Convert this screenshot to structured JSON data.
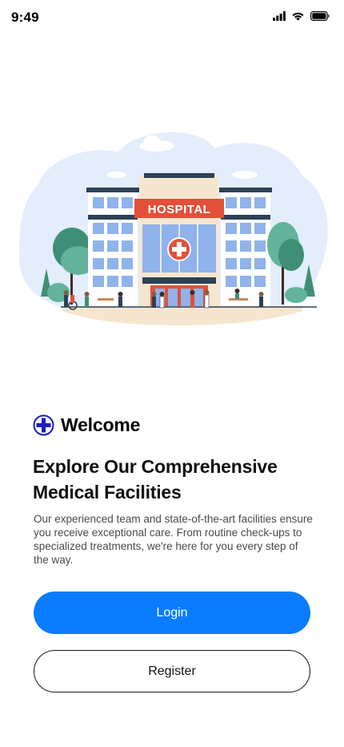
{
  "status_bar": {
    "time": "9:49",
    "icons": [
      "signal-icon",
      "wifi-icon",
      "battery-icon"
    ]
  },
  "illustration": {
    "sign_text": "HOSPITAL",
    "icon": "hospital-building-illustration"
  },
  "welcome": {
    "icon": "medical-cross-icon",
    "title": "Welcome"
  },
  "headline": "Explore Our Comprehensive Medical Facilities",
  "description": "Our experienced team and state-of-the-art facilities ensure you receive exceptional care.  From routine check-ups to specialized treatments, we're here for you every step of the way.",
  "buttons": {
    "login_label": "Login",
    "register_label": "Register"
  },
  "colors": {
    "primary": "#0a7cff",
    "sign_red": "#e2503a",
    "sky_blob": "#e3edfb",
    "cross_icon": "#1b1bc7"
  }
}
